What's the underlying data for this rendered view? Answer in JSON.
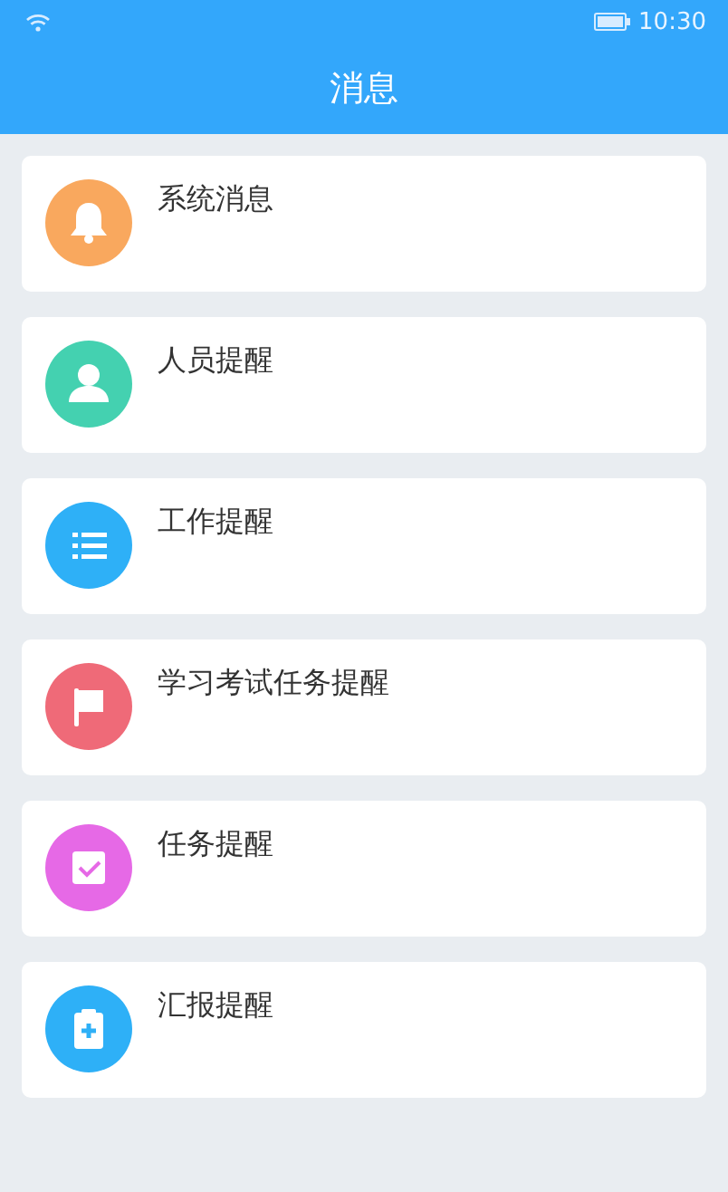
{
  "status_bar": {
    "time": "10:30"
  },
  "header": {
    "title": "消息"
  },
  "items": [
    {
      "label": "系统消息",
      "kind": "bell",
      "color": "#f9a85e"
    },
    {
      "label": "人员提醒",
      "kind": "person",
      "color": "#44d1b0"
    },
    {
      "label": "工作提醒",
      "kind": "list",
      "color": "#2eb0f7"
    },
    {
      "label": "学习考试任务提醒",
      "kind": "flag",
      "color": "#ef6a78"
    },
    {
      "label": "任务提醒",
      "kind": "check",
      "color": "#e669e6"
    },
    {
      "label": "汇报提醒",
      "kind": "clipboard",
      "color": "#2eb0f7"
    }
  ]
}
